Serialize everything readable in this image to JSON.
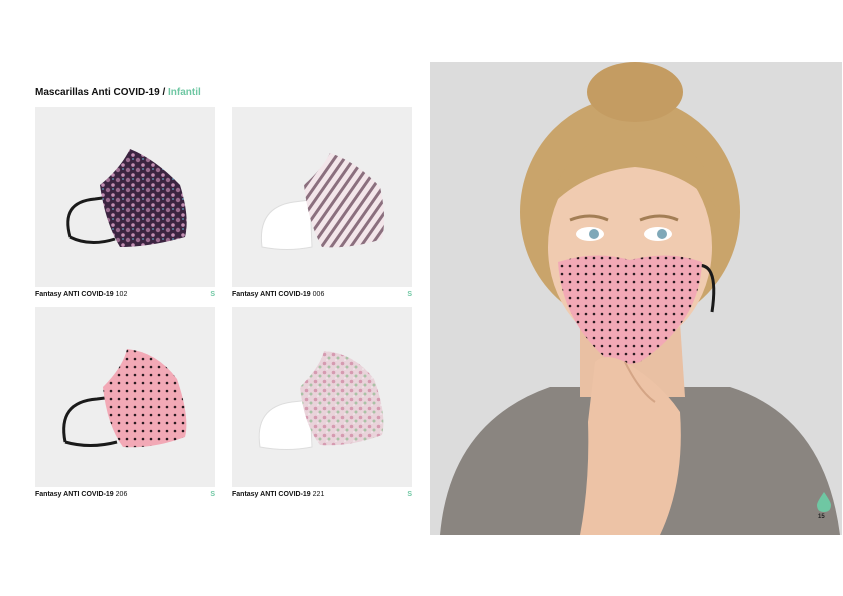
{
  "header": {
    "title": "Mascarillas Anti COVID-19",
    "separator": " / ",
    "subtitle": "Infantil"
  },
  "products": [
    {
      "name": "Fantasy ANTI COVID-19",
      "code": "102",
      "size": "S",
      "pattern": "snake-print"
    },
    {
      "name": "Fantasy ANTI COVID-19",
      "code": "006",
      "size": "S",
      "pattern": "stripes"
    },
    {
      "name": "Fantasy ANTI COVID-19",
      "code": "206",
      "size": "S",
      "pattern": "polka-dots"
    },
    {
      "name": "Fantasy ANTI COVID-19",
      "code": "221",
      "size": "S",
      "pattern": "floral"
    }
  ],
  "page": {
    "number": "15"
  },
  "colors": {
    "accent": "#6fc7a3",
    "mask_pink": "#f2a9b6",
    "card_bg": "#eeeeee"
  }
}
